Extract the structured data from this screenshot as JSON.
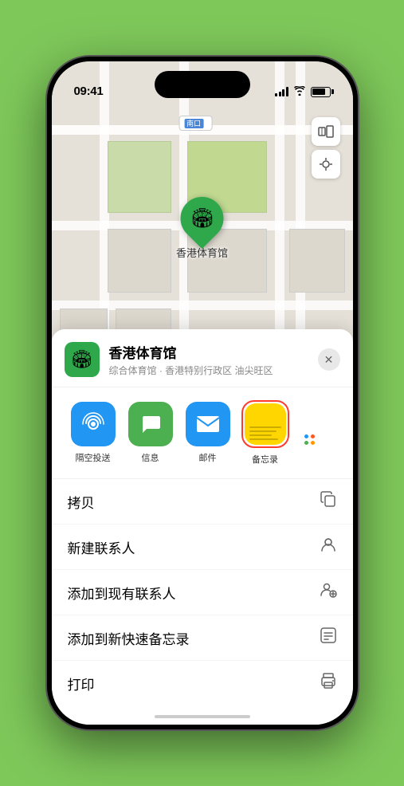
{
  "status_bar": {
    "time": "09:41",
    "location_arrow": "▶"
  },
  "map": {
    "label": "南口",
    "marker_label": "香港体育馆"
  },
  "venue": {
    "name": "香港体育馆",
    "subtitle": "综合体育馆 · 香港特别行政区 油尖旺区",
    "logo_emoji": "🏟"
  },
  "share_items": [
    {
      "id": "airdrop",
      "label": "隔空投送",
      "type": "airdrop"
    },
    {
      "id": "messages",
      "label": "信息",
      "type": "messages"
    },
    {
      "id": "mail",
      "label": "邮件",
      "type": "mail"
    },
    {
      "id": "notes",
      "label": "备忘录",
      "type": "notes",
      "selected": true
    }
  ],
  "action_items": [
    {
      "label": "拷贝",
      "icon": "copy"
    },
    {
      "label": "新建联系人",
      "icon": "person"
    },
    {
      "label": "添加到现有联系人",
      "icon": "person-add"
    },
    {
      "label": "添加到新快速备忘录",
      "icon": "note"
    },
    {
      "label": "打印",
      "icon": "print"
    }
  ],
  "close_button_label": "✕"
}
